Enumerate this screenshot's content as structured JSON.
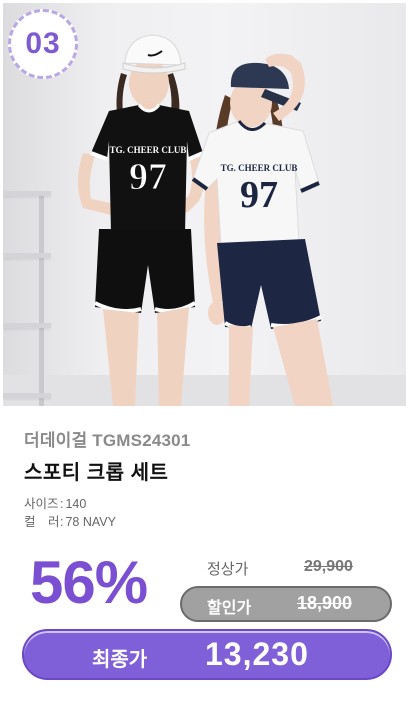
{
  "rank": "03",
  "product": {
    "brand": "더데이걸 TGMS24301",
    "name": "스포티 크롭 세트",
    "options": [
      {
        "key": "사이즈",
        "value": "140"
      },
      {
        "key": "컬　러",
        "value": "78 NAVY"
      }
    ]
  },
  "shirt_print": {
    "left": {
      "line1": "TG. CHEER CLUB",
      "number": "97"
    },
    "right": {
      "line1": "TG. CHEER CLUB",
      "number": "97"
    }
  },
  "pricing": {
    "discount_percent": "56%",
    "regular_label": "정상가",
    "regular_price": "29,900",
    "discount_label": "할인가",
    "discount_price": "18,900",
    "final_label": "최종가",
    "final_price": "13,230"
  },
  "colors": {
    "accent": "#7a4fd2",
    "final_pill": "#8060d8",
    "discount_pill": "#a1a1a1",
    "badge_border": "#b9a7e6"
  }
}
